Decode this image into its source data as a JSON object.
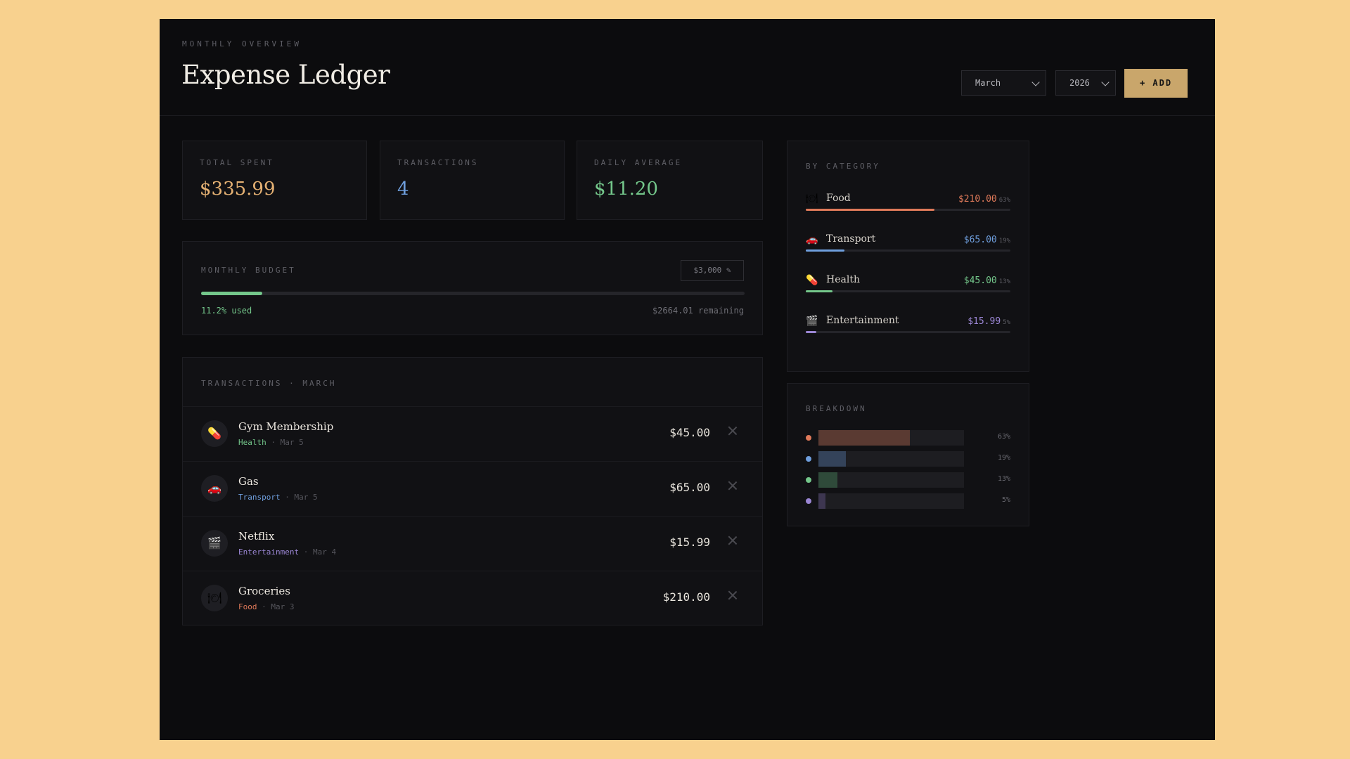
{
  "header": {
    "eyebrow": "MONTHLY OVERVIEW",
    "title": "Expense Ledger",
    "month_select": "March",
    "year_select": "2026",
    "add_label": "+ ADD"
  },
  "stats": {
    "total_label": "TOTAL SPENT",
    "total_value": "$335.99",
    "tx_label": "TRANSACTIONS",
    "tx_value": "4",
    "avg_label": "DAILY AVERAGE",
    "avg_value": "$11.20"
  },
  "budget": {
    "label": "MONTHLY BUDGET",
    "amount": "$3,000 ✎",
    "used_text": "11.2% used",
    "used_fraction": 0.112,
    "remaining_text": "$2664.01 remaining"
  },
  "transactions": {
    "heading": "TRANSACTIONS · MARCH",
    "items": [
      {
        "name": "Gym Membership",
        "category": "Health",
        "date": "Mar 5",
        "amount": "$45.00",
        "icon": "pill-icon",
        "glyph": "💊",
        "color": "#74c78b"
      },
      {
        "name": "Gas",
        "category": "Transport",
        "date": "Mar 5",
        "amount": "$65.00",
        "icon": "car-icon",
        "glyph": "🚗",
        "color": "#6f9fde"
      },
      {
        "name": "Netflix",
        "category": "Entertainment",
        "date": "Mar 4",
        "amount": "$15.99",
        "icon": "clapper-icon",
        "glyph": "🎬",
        "color": "#9b86d4"
      },
      {
        "name": "Groceries",
        "category": "Food",
        "date": "Mar 3",
        "amount": "$210.00",
        "icon": "plate-icon",
        "glyph": "🍽",
        "color": "#e07a5a"
      }
    ],
    "separator": "·"
  },
  "by_category": {
    "heading": "BY CATEGORY",
    "items": [
      {
        "name": "Food",
        "amount": "$210.00",
        "pct": "63%",
        "fraction": 0.63,
        "color": "#e07a5a",
        "icon": "plate-icon",
        "glyph": "🍽"
      },
      {
        "name": "Transport",
        "amount": "$65.00",
        "pct": "19%",
        "fraction": 0.19,
        "color": "#6f9fde",
        "icon": "car-icon",
        "glyph": "🚗"
      },
      {
        "name": "Health",
        "amount": "$45.00",
        "pct": "13%",
        "fraction": 0.13,
        "color": "#74c78b",
        "icon": "pill-icon",
        "glyph": "💊"
      },
      {
        "name": "Entertainment",
        "amount": "$15.99",
        "pct": "5%",
        "fraction": 0.05,
        "color": "#9b86d4",
        "icon": "clapper-icon",
        "glyph": "🎬"
      }
    ]
  },
  "breakdown": {
    "heading": "BREAKDOWN",
    "items": [
      {
        "pct": "63%",
        "fraction": 0.63,
        "color": "#e07a5a",
        "bar": "#5a3a32"
      },
      {
        "pct": "19%",
        "fraction": 0.19,
        "color": "#6f9fde",
        "bar": "#34435a"
      },
      {
        "pct": "13%",
        "fraction": 0.13,
        "color": "#74c78b",
        "bar": "#2f4a3a"
      },
      {
        "pct": "5%",
        "fraction": 0.05,
        "color": "#9b86d4",
        "bar": "#3d3650"
      }
    ]
  },
  "colors": {
    "accent": "#c9a66b",
    "total": "#e5b173",
    "count": "#6f9fde",
    "avg": "#74c78b"
  }
}
